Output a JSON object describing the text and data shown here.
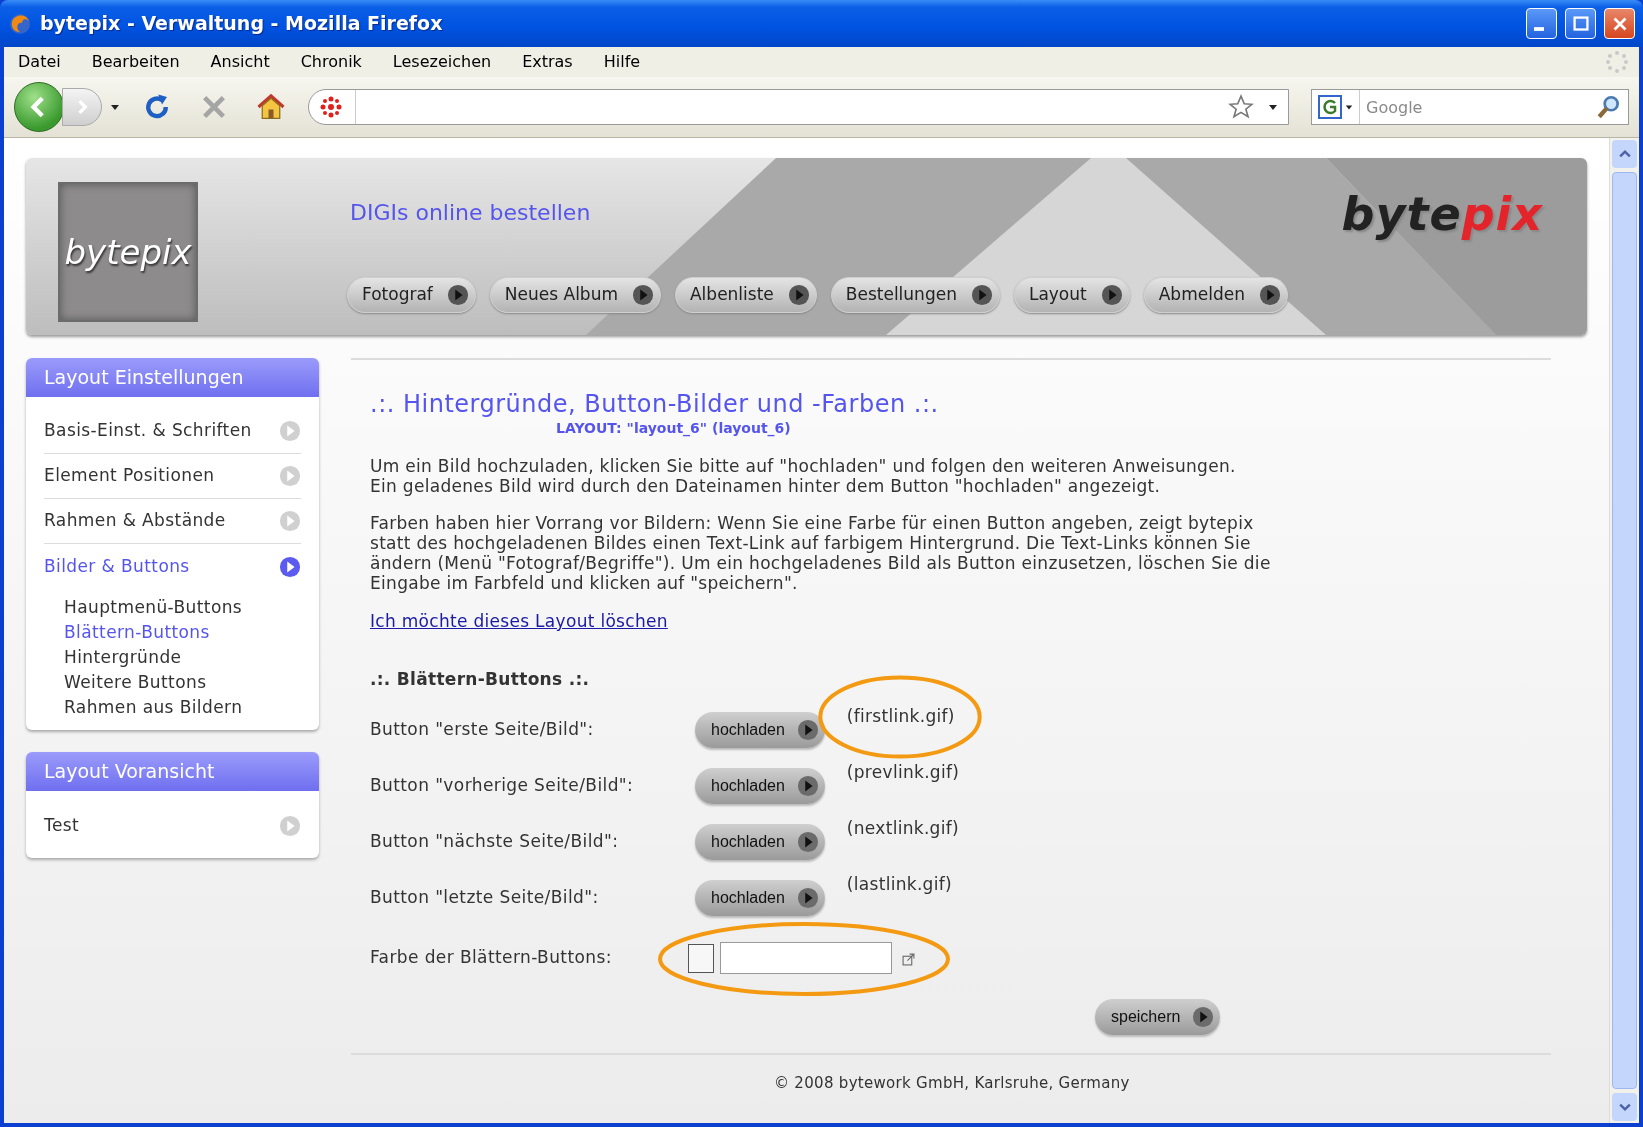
{
  "window": {
    "title": "bytepix - Verwaltung - Mozilla Firefox"
  },
  "menu_bar": [
    "Datei",
    "Bearbeiten",
    "Ansicht",
    "Chronik",
    "Lesezeichen",
    "Extras",
    "Hilfe"
  ],
  "search_box": {
    "placeholder": "Google"
  },
  "header": {
    "logo_text": "bytepix",
    "tagline": "DIGIs online bestellen",
    "brand_dark": "byte",
    "brand_accent": "pix",
    "nav": [
      "Fotograf",
      "Neues Album",
      "Albenliste",
      "Bestellungen",
      "Layout",
      "Abmelden"
    ]
  },
  "sidebar": {
    "sections": [
      {
        "title": "Layout Einstellungen",
        "items": [
          {
            "label": "Basis-Einst. & Schriften",
            "selected": false
          },
          {
            "label": "Element Positionen",
            "selected": false
          },
          {
            "label": "Rahmen & Abstände",
            "selected": false
          },
          {
            "label": "Bilder & Buttons",
            "selected": true,
            "children": [
              {
                "label": "Hauptmenü-Buttons",
                "selected": false
              },
              {
                "label": "Blättern-Buttons",
                "selected": true
              },
              {
                "label": "Hintergründe",
                "selected": false
              },
              {
                "label": "Weitere Buttons",
                "selected": false
              },
              {
                "label": "Rahmen aus Bildern",
                "selected": false
              }
            ]
          }
        ]
      },
      {
        "title": "Layout Voransicht",
        "items": [
          {
            "label": "Test",
            "selected": false
          }
        ]
      }
    ]
  },
  "main": {
    "title": ".:. Hintergründe, Button-Bilder und -Farben .:.",
    "subtitle": "LAYOUT: \"layout_6\" (layout_6)",
    "paragraphs": [
      "Um ein Bild hochzuladen, klicken Sie bitte auf \"hochladen\" und folgen den weiteren Anweisungen.\nEin geladenes Bild wird durch den Dateinamen hinter dem Button \"hochladen\" angezeigt.",
      "Farben haben hier Vorrang vor Bildern: Wenn Sie eine Farbe für einen Button angeben, zeigt bytepix\nstatt des hochgeladenen Bildes einen Text-Link auf farbigem Hintergrund. Die Text-Links können Sie\nändern (Menü \"Fotograf/Begriffe\"). Um ein hochgeladenes Bild als Button einzusetzen, löschen Sie die\nEingabe im Farbfeld und klicken auf \"speichern\"."
    ],
    "delete_link": "Ich möchte dieses Layout löschen",
    "section_title": ".:. Blättern-Buttons .:.",
    "upload_rows": [
      {
        "label": "Button \"erste Seite/Bild\":",
        "button": "hochladen",
        "file": "(firstlink.gif)",
        "highlighted": true
      },
      {
        "label": "Button \"vorherige Seite/Bild\":",
        "button": "hochladen",
        "file": "(prevlink.gif)",
        "highlighted": false
      },
      {
        "label": "Button \"nächste Seite/Bild\":",
        "button": "hochladen",
        "file": "(nextlink.gif)",
        "highlighted": false
      },
      {
        "label": "Button \"letzte Seite/Bild\":",
        "button": "hochladen",
        "file": "(lastlink.gif)",
        "highlighted": false
      }
    ],
    "color_row": {
      "label": "Farbe der Blättern-Buttons:",
      "highlighted": true
    },
    "save_button": "speichern"
  },
  "footer": "© 2008 bytework GmbH, Karlsruhe, Germany"
}
